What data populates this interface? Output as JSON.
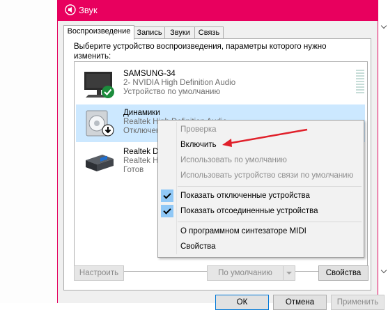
{
  "window": {
    "title": "Звук",
    "accent": "#e8005e"
  },
  "tabs": [
    {
      "label": "Воспроизведение",
      "active": true
    },
    {
      "label": "Запись",
      "active": false
    },
    {
      "label": "Звуки",
      "active": false
    },
    {
      "label": "Связь",
      "active": false
    }
  ],
  "description": "Выберите устройство воспроизведения, параметры которого нужно изменить:",
  "devices": [
    {
      "name": "SAMSUNG-34",
      "line1": "2- NVIDIA High Definition Audio",
      "line2": "Устройство по умолчанию",
      "icon": "monitor-icon",
      "status_icon": "default-check-icon"
    },
    {
      "name": "Динамики",
      "line1": "Realtek High Definition Audio",
      "line2": "Отключено",
      "icon": "speaker-icon",
      "status_icon": "disabled-arrow-icon",
      "selected": true
    },
    {
      "name": "Realtek Di",
      "line1": "Realtek Hi",
      "line2": "Готов",
      "icon": "digital-output-icon"
    }
  ],
  "context_menu": {
    "items": [
      {
        "label": "Проверка",
        "enabled": false
      },
      {
        "label": "Включить",
        "enabled": true
      },
      {
        "label": "Использовать по умолчанию",
        "enabled": false
      },
      {
        "label": "Использовать устройство связи по умолчанию",
        "enabled": false
      },
      {
        "label": "Показать отключенные устройства",
        "enabled": true,
        "checked": true
      },
      {
        "label": "Показать отсоединенные устройства",
        "enabled": true,
        "checked": true
      },
      {
        "label": "О программном синтезаторе MIDI",
        "enabled": true
      },
      {
        "label": "Свойства",
        "enabled": true
      }
    ]
  },
  "buttons": {
    "configure": "Настроить",
    "set_default": "По умолчанию",
    "properties": "Свойства",
    "ok": "ОК",
    "cancel": "Отмена",
    "apply": "Применить"
  },
  "annotation_color": "#e0202a"
}
